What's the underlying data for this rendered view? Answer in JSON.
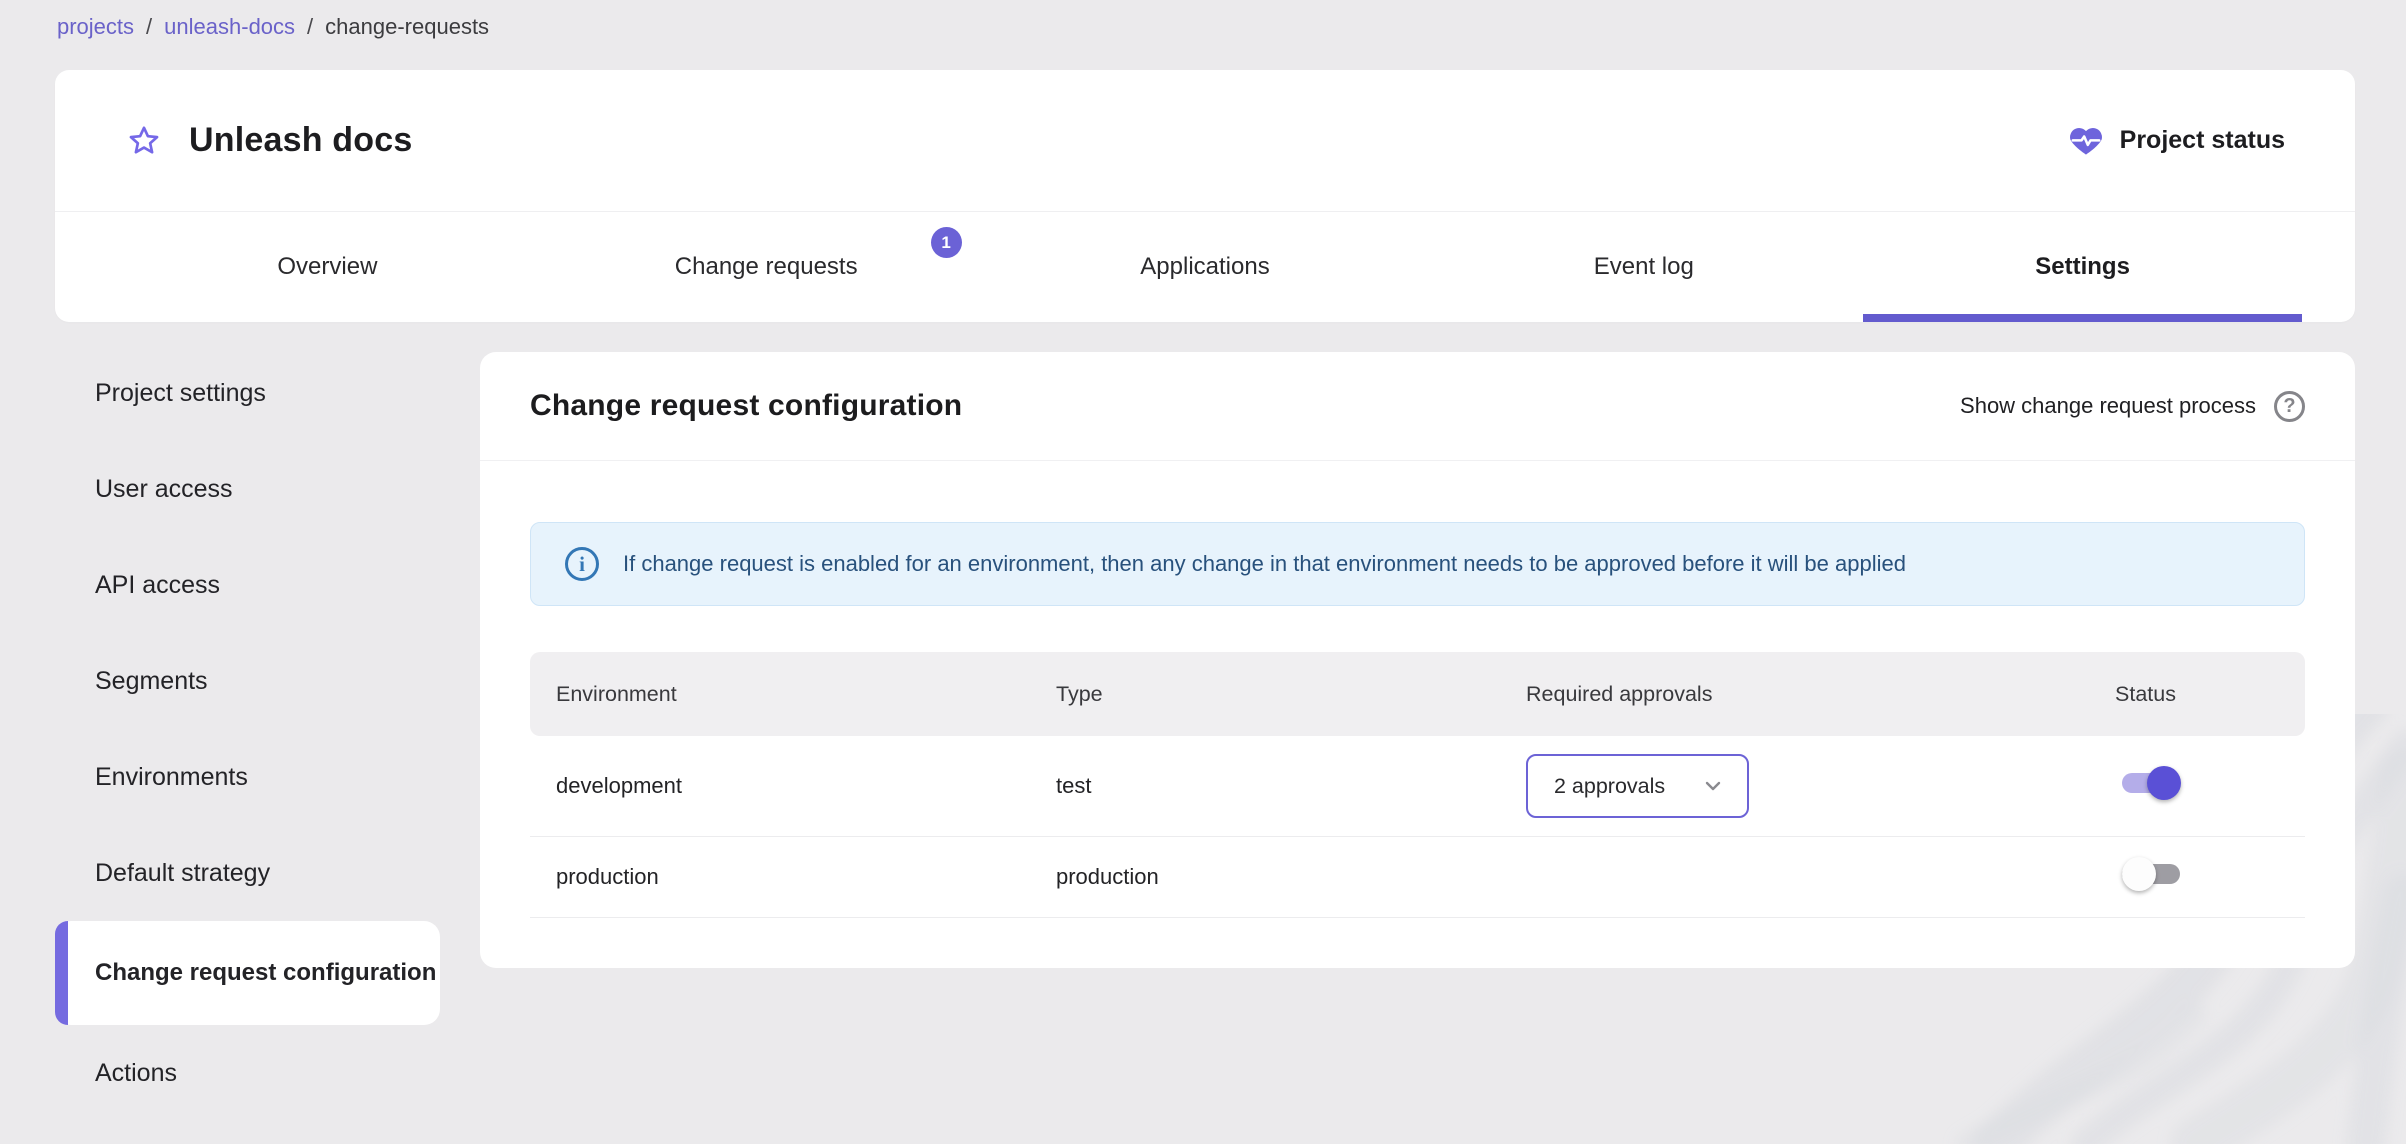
{
  "colors": {
    "accent": "#635bce",
    "accent_light": "#b4ade9",
    "badge": "#6b62d6",
    "link": "#6a62c9",
    "info_background": "#e7f3fc",
    "info_text": "#28517c",
    "info_icon": "#3377b5",
    "toggle_on_thumb": "#5a50d6",
    "toggle_off_track": "#9e9da3"
  },
  "breadcrumb": {
    "separator": "/",
    "items": [
      {
        "label": "projects"
      },
      {
        "label": "unleash-docs"
      },
      {
        "label": "change-requests"
      }
    ]
  },
  "header": {
    "title": "Unleash docs",
    "favorite_icon": "star-outline-icon",
    "status_icon": "heart-pulse-icon",
    "status_label": "Project status"
  },
  "tabs": [
    {
      "label": "Overview",
      "active": false
    },
    {
      "label": "Change requests",
      "badge": "1",
      "active": false
    },
    {
      "label": "Applications",
      "active": false
    },
    {
      "label": "Event log",
      "active": false
    },
    {
      "label": "Settings",
      "active": true
    }
  ],
  "sidebar": {
    "items": [
      {
        "label": "Project settings",
        "active": false
      },
      {
        "label": "User access",
        "active": false
      },
      {
        "label": "API access",
        "active": false
      },
      {
        "label": "Segments",
        "active": false
      },
      {
        "label": "Environments",
        "active": false
      },
      {
        "label": "Default strategy",
        "active": false
      },
      {
        "label": "Change request configuration",
        "active": true
      },
      {
        "label": "Actions",
        "active": false
      }
    ]
  },
  "panel": {
    "title": "Change request configuration",
    "help_label": "Show change request process",
    "help_icon": "?",
    "info_icon": "i",
    "info_text": "If change request is enabled for an environment, then any change in that environment needs to be approved before it will be applied",
    "table": {
      "columns": [
        "Environment",
        "Type",
        "Required approvals",
        "Status"
      ],
      "rows": [
        {
          "environment": "development",
          "type": "test",
          "required_approvals": "2 approvals",
          "status_enabled": true
        },
        {
          "environment": "production",
          "type": "production",
          "required_approvals": "",
          "status_enabled": false
        }
      ]
    }
  }
}
